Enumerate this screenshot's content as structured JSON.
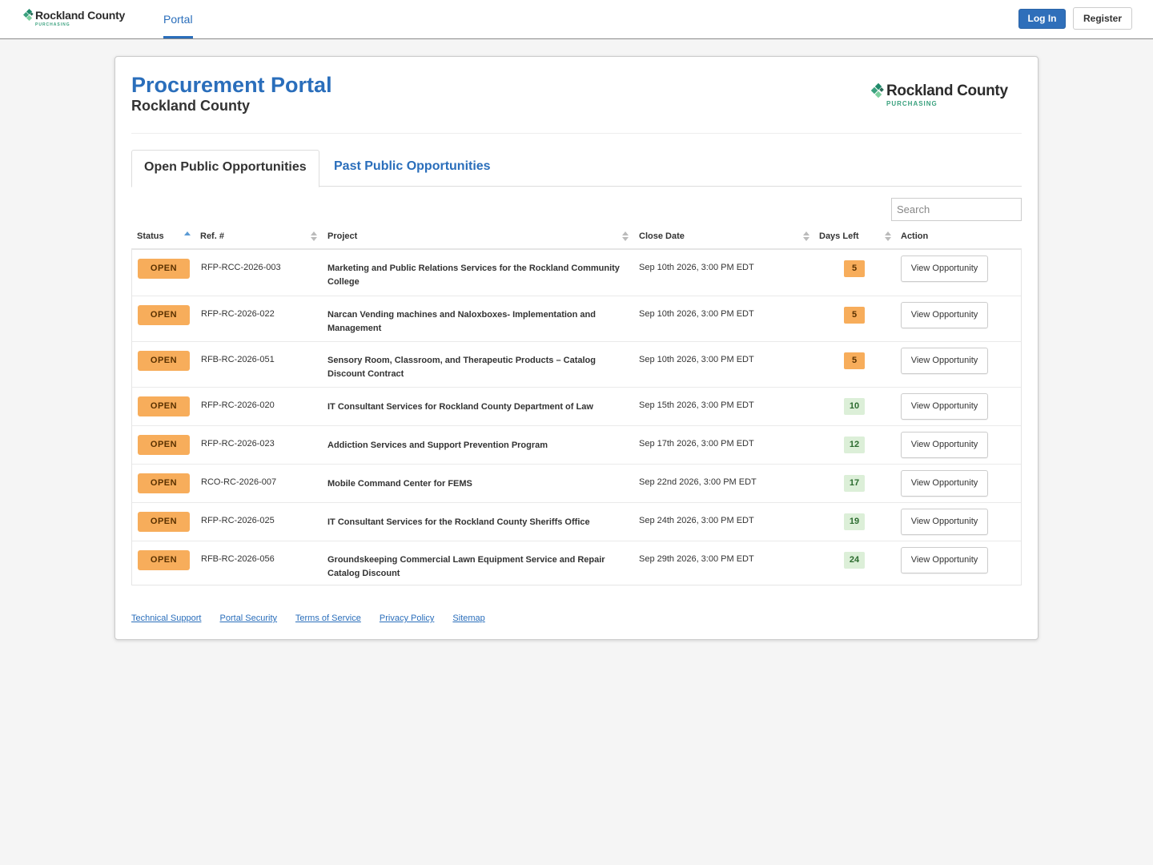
{
  "brand": {
    "name": "Rockland County",
    "sub": "PURCHASING",
    "colors": {
      "dark": "#2b2b2b",
      "green": "#3aa17e",
      "teal": "#1f8a6a",
      "light_green": "#7ccf9e"
    }
  },
  "nav": {
    "portal_label": "Portal",
    "login_label": "Log In",
    "register_label": "Register"
  },
  "header": {
    "title": "Procurement Portal",
    "subtitle": "Rockland County"
  },
  "tabs": [
    {
      "label": "Open Public Opportunities",
      "active": true
    },
    {
      "label": "Past Public Opportunities",
      "active": false
    }
  ],
  "search": {
    "placeholder": "Search",
    "value": ""
  },
  "table": {
    "columns": [
      {
        "label": "Status",
        "sort": "asc"
      },
      {
        "label": "Ref. #",
        "sort": "none"
      },
      {
        "label": "Project",
        "sort": "none"
      },
      {
        "label": "Close Date",
        "sort": "none"
      },
      {
        "label": "Days Left",
        "sort": "none"
      },
      {
        "label": "Action",
        "sort": ""
      }
    ],
    "rows": [
      {
        "status": "OPEN",
        "ref": "RFP-RCC-2026-003",
        "project": "Marketing and Public Relations Services for the Rockland Community College",
        "close": "Sep 10th 2026, 3:00 PM EDT",
        "days": "5",
        "level": "warn",
        "action": "View Opportunity"
      },
      {
        "status": "OPEN",
        "ref": "RFP-RC-2026-022",
        "project": "Narcan Vending machines and Naloxboxes- Implementation and Management",
        "close": "Sep 10th 2026, 3:00 PM EDT",
        "days": "5",
        "level": "warn",
        "action": "View Opportunity"
      },
      {
        "status": "OPEN",
        "ref": "RFB-RC-2026-051",
        "project": "Sensory Room, Classroom, and Therapeutic Products – Catalog Discount Contract",
        "close": "Sep 10th 2026, 3:00 PM EDT",
        "days": "5",
        "level": "warn",
        "action": "View Opportunity"
      },
      {
        "status": "OPEN",
        "ref": "RFP-RC-2026-020",
        "project": "IT Consultant Services for Rockland County Department of Law",
        "close": "Sep 15th 2026, 3:00 PM EDT",
        "days": "10",
        "level": "ok",
        "action": "View Opportunity"
      },
      {
        "status": "OPEN",
        "ref": "RFP-RC-2026-023",
        "project": "Addiction Services and Support Prevention Program",
        "close": "Sep 17th 2026, 3:00 PM EDT",
        "days": "12",
        "level": "ok",
        "action": "View Opportunity"
      },
      {
        "status": "OPEN",
        "ref": "RCO-RC-2026-007",
        "project": "Mobile Command Center for FEMS",
        "close": "Sep 22nd 2026, 3:00 PM EDT",
        "days": "17",
        "level": "ok",
        "action": "View Opportunity"
      },
      {
        "status": "OPEN",
        "ref": "RFP-RC-2026-025",
        "project": "IT Consultant Services for the Rockland County Sheriffs Office",
        "close": "Sep 24th 2026, 3:00 PM EDT",
        "days": "19",
        "level": "ok",
        "action": "View Opportunity"
      },
      {
        "status": "OPEN",
        "ref": "RFB-RC-2026-056",
        "project": "Groundskeeping Commercial Lawn Equipment Service and Repair Catalog Discount",
        "close": "Sep 29th 2026, 3:00 PM EDT",
        "days": "24",
        "level": "ok",
        "action": "View Opportunity"
      }
    ]
  },
  "footer": {
    "links": [
      "Technical Support",
      "Portal Security",
      "Terms of Service",
      "Privacy Policy",
      "Sitemap"
    ]
  }
}
